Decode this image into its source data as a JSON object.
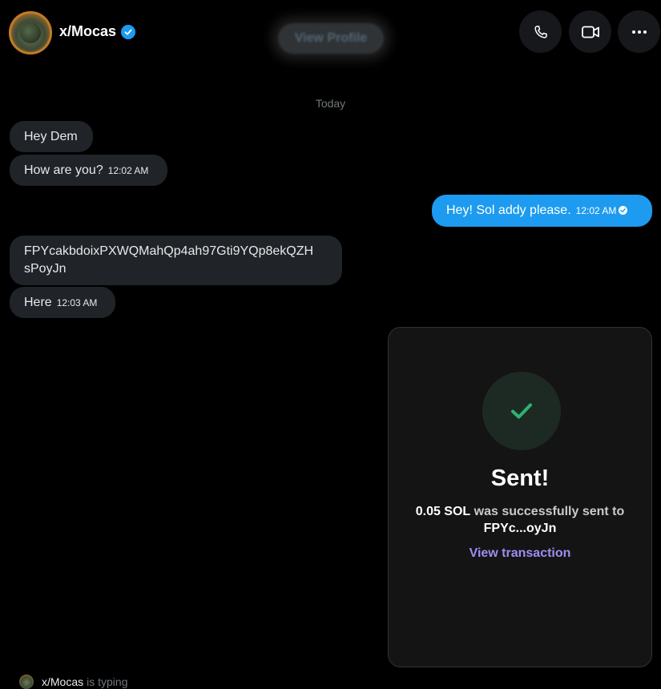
{
  "header": {
    "name": "x/Mocas",
    "view_profile": "View Profile",
    "buttons": [
      "phone-icon",
      "video-icon",
      "more-icon"
    ]
  },
  "day_label": "Today",
  "messages": [
    {
      "text": "Hey Dem",
      "time": "",
      "direction": "in"
    },
    {
      "text": "How are you?",
      "time": "12:02 AM",
      "direction": "in"
    },
    {
      "text": "Hey! Sol addy please.",
      "time": "12:02 AM",
      "direction": "out",
      "status": "read"
    },
    {
      "text_line1": "FPYcakbdoixPXWQMahQp4ah97Gti9YQp8ekQZH",
      "text_line2": "sPoyJn",
      "direction": "in"
    },
    {
      "text": "Here",
      "time": "12:03 AM",
      "direction": "in"
    }
  ],
  "transfer_card": {
    "title": "Sent!",
    "amount": "0.05 SOL",
    "message_mid": " was successfully sent to",
    "recipient": "FPYc...oyJn",
    "link": "View transaction"
  },
  "typing": {
    "name": "x/Mocas",
    "suffix": "is typing"
  },
  "colors": {
    "background": "#000000",
    "incoming_bubble": "#202327",
    "outgoing_bubble": "#1d9bf0",
    "success": "#2fb36f",
    "link": "#a08cf0"
  }
}
